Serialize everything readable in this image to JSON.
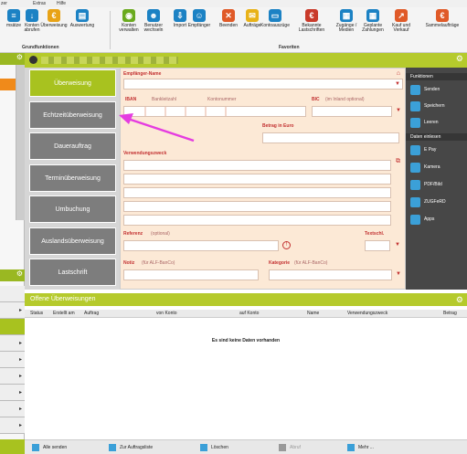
{
  "menu": {
    "items": [
      "zer",
      "Extras",
      "Hilfe"
    ]
  },
  "ribbon": {
    "buttons": [
      {
        "label": "msätze",
        "icon": "list-icon",
        "color": "#1c82c4"
      },
      {
        "label": "Konten abrufen",
        "icon": "download-icon",
        "color": "#1c82c4"
      },
      {
        "label": "Überweisung",
        "icon": "euro-icon",
        "color": "#e8a317"
      },
      {
        "label": "Auswertung",
        "icon": "chart-icon",
        "color": "#1c82c4"
      },
      {
        "label": "Konten verwalten",
        "icon": "accounts-icon",
        "color": "#6aaa1e"
      },
      {
        "label": "Benutzer wechseln",
        "icon": "users-icon",
        "color": "#1c82c4"
      },
      {
        "label": "Import",
        "icon": "import-icon",
        "color": "#1c82c4"
      },
      {
        "label": "Empfänger",
        "icon": "person-icon",
        "color": "#1c82c4"
      },
      {
        "label": "Beenden",
        "icon": "close-icon",
        "color": "#e05a28"
      },
      {
        "label": "Aufträge",
        "icon": "mail-icon",
        "color": "#e8b218"
      },
      {
        "label": "Kontoauszüge",
        "icon": "statement-icon",
        "color": "#1c82c4"
      },
      {
        "label": "Bekannte Lastschriften",
        "icon": "euro-check-icon",
        "color": "#c93a2a"
      },
      {
        "label": "Zugänge / Medien",
        "icon": "media-icon",
        "color": "#1c82c4"
      },
      {
        "label": "Geplante Zahlungen",
        "icon": "calendar-euro-icon",
        "color": "#1c82c4"
      },
      {
        "label": "Kauf und Verkauf",
        "icon": "trend-icon",
        "color": "#e05a28"
      },
      {
        "label": "Sammelaufträge",
        "icon": "batch-euro-icon",
        "color": "#e05a28"
      }
    ],
    "group1": "Grundfunktionen",
    "group2": "Favoriten"
  },
  "categories": [
    {
      "label": "Überweisung",
      "active": true
    },
    {
      "label": "Echtzeitüberweisung",
      "active": false
    },
    {
      "label": "Dauerauftrag",
      "active": false
    },
    {
      "label": "Terminüberweisung",
      "active": false
    },
    {
      "label": "Umbuchung",
      "active": false
    },
    {
      "label": "Auslandsüberweisung",
      "active": false
    },
    {
      "label": "Lastschrift",
      "active": false
    }
  ],
  "form": {
    "recipient_label": "Empfänger-Name",
    "iban_label": "IBAN",
    "bankcode_label": "Bankleitzahl",
    "account_label": "Kontonummer",
    "bic_label": "BIC",
    "bic_note": "(im Inland optional)",
    "amount_label": "Betrag in Euro",
    "purpose_label": "Verwendungszweck",
    "reference_label": "Referenz",
    "reference_note": "(optional)",
    "textkey_label": "Textschl.",
    "note_label": "Notiz",
    "note_note": "(für ALF-BanCo)",
    "category_label": "Kategorie",
    "category_note": "(für ALF-BanCo)"
  },
  "functions": {
    "title": "Funktionen",
    "items": [
      "Senden",
      "Speichern",
      "Leeren"
    ],
    "read_title": "Daten einlesen",
    "read_items": [
      "E Pay",
      "Kamera",
      "PDF/Bild",
      "ZUGFeRD",
      "Apps"
    ]
  },
  "pending": {
    "title": "Offene Überweisungen",
    "columns": [
      "Status",
      "Erstellt am",
      "Auftrag",
      "von Konto",
      "auf Konto",
      "Name",
      "Verwendungszweck",
      "Betrag"
    ],
    "empty_message": "Es sind keine Daten vorhanden"
  },
  "bottom_bar": {
    "buttons": [
      "Alle senden",
      "Zur Auftragsliste",
      "Löschen",
      "Abruf",
      "Mehr ..."
    ]
  },
  "colors": {
    "accent_green": "#b5ca2c",
    "active_category": "#a8c21f",
    "inactive_category": "#7d7d7d",
    "form_bg": "#fce9d6",
    "side_panel": "#474747",
    "annotation_arrow": "#e53ce0"
  }
}
